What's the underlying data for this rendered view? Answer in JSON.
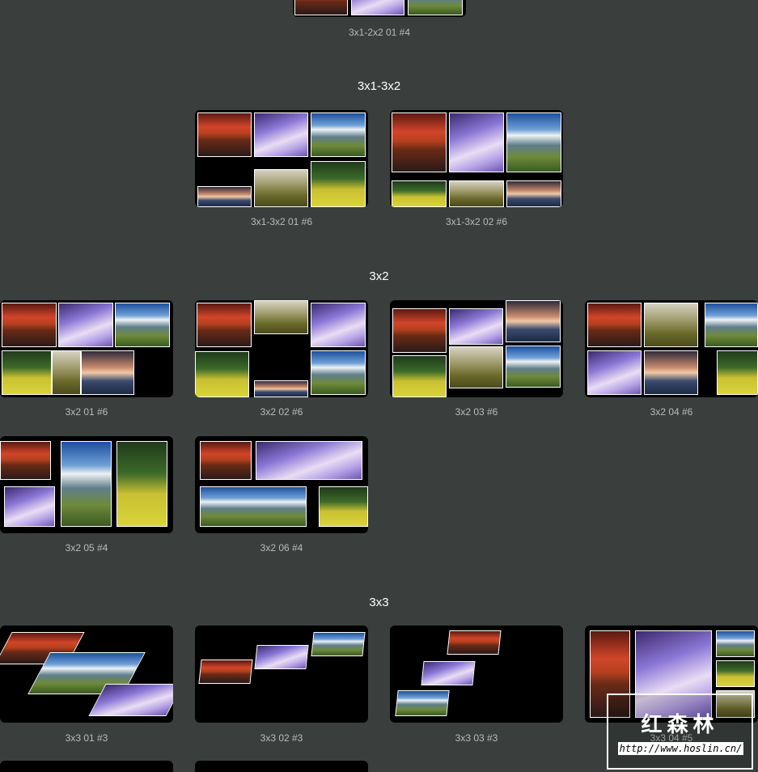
{
  "sections": {
    "s3x1_3x2": "3x1-3x2",
    "s3x2": "3x2",
    "s3x3": "3x3"
  },
  "captions": {
    "top": "3x1-2x2 01 #4",
    "c3x1_3x2_01": "3x1-3x2 01 #6",
    "c3x1_3x2_02": "3x1-3x2 02 #6",
    "c3x2_01": "3x2 01 #6",
    "c3x2_02": "3x2 02 #6",
    "c3x2_03": "3x2 03 #6",
    "c3x2_04": "3x2 04 #6",
    "c3x2_05": "3x2 05 #4",
    "c3x2_06": "3x2 06 #4",
    "c3x3_01": "3x3 01 #3",
    "c3x3_02": "3x3 02 #3",
    "c3x3_03": "3x3 03 #3",
    "c3x3_04": "3x3 04 #5"
  },
  "watermark": {
    "cn": "红森林",
    "url": "http://www.hoslin.cn/"
  },
  "colors": {
    "background": "#3a3f3e",
    "card": "#000000",
    "caption": "#b8bcbb",
    "photo_border": "#ffffff"
  }
}
